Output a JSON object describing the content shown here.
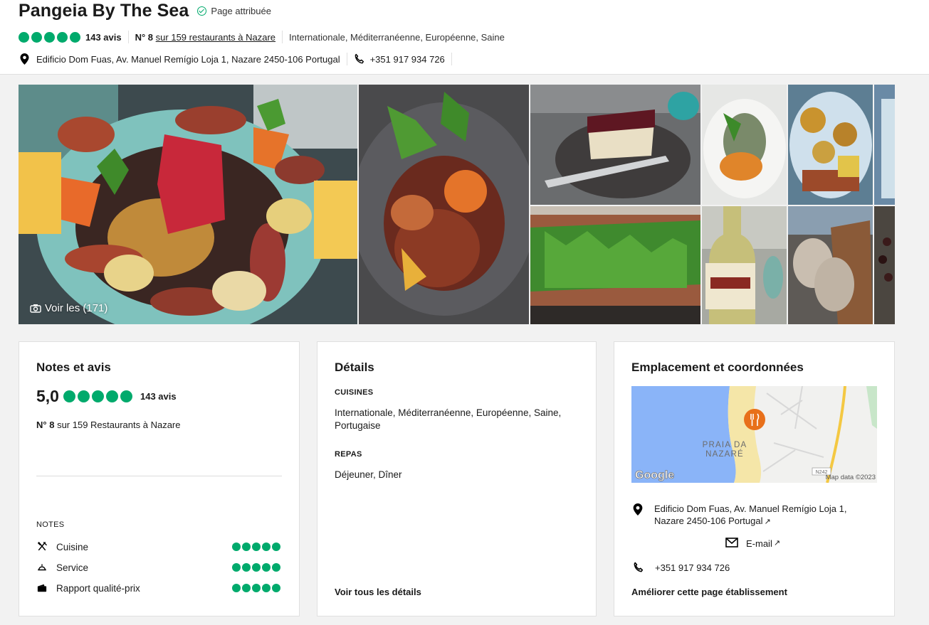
{
  "header": {
    "title": "Pangeia By The Sea",
    "claimed": "Page attribuée",
    "review_count": "143 avis",
    "rank_prefix": "N° 8",
    "rank_text": "sur 159 restaurants à Nazare",
    "cuisines": "Internationale, Méditerranéenne, Européenne, Saine",
    "address": "Edificio Dom Fuas, Av. Manuel Remígio Loja 1, Nazare 2450-106 Portugal",
    "phone": "+351 917 934 726",
    "rating_fraction": 1.0
  },
  "gallery": {
    "view_all": "Voir les (171)"
  },
  "ratings_card": {
    "title": "Notes et avis",
    "score": "5,0",
    "review_count": "143 avis",
    "rank_prefix": "N° 8",
    "rank_text": "sur 159 Restaurants à Nazare",
    "notes_label": "NOTES",
    "notes": [
      {
        "label": "Cuisine",
        "icon": "utensils-icon",
        "rating": 5
      },
      {
        "label": "Service",
        "icon": "cloche-icon",
        "rating": 5
      },
      {
        "label": "Rapport qualité-prix",
        "icon": "wallet-icon",
        "rating": 5
      }
    ]
  },
  "details_card": {
    "title": "Détails",
    "cuisines_label": "CUISINES",
    "cuisines_value": "Internationale, Méditerranéenne, Européenne, Saine, Portugaise",
    "meals_label": "REPAS",
    "meals_value": "Déjeuner, Dîner",
    "see_all": "Voir tous les détails"
  },
  "location_card": {
    "title": "Emplacement et coordonnées",
    "map_label_line1": "PRAIA DA",
    "map_label_line2": "NAZARÉ",
    "map_logo": "Google",
    "map_data": "Map data ©2023",
    "map_road": "N242",
    "address_line1": "Edificio Dom Fuas, Av. Manuel Remígio Loja 1,",
    "address_line2": "Nazare 2450-106 Portugal",
    "email": "E-mail",
    "phone": "+351 917 934 726",
    "improve": "Améliorer cette page établissement"
  },
  "colors": {
    "brand_green": "#00aa6c",
    "background": "#f2f2f2"
  }
}
